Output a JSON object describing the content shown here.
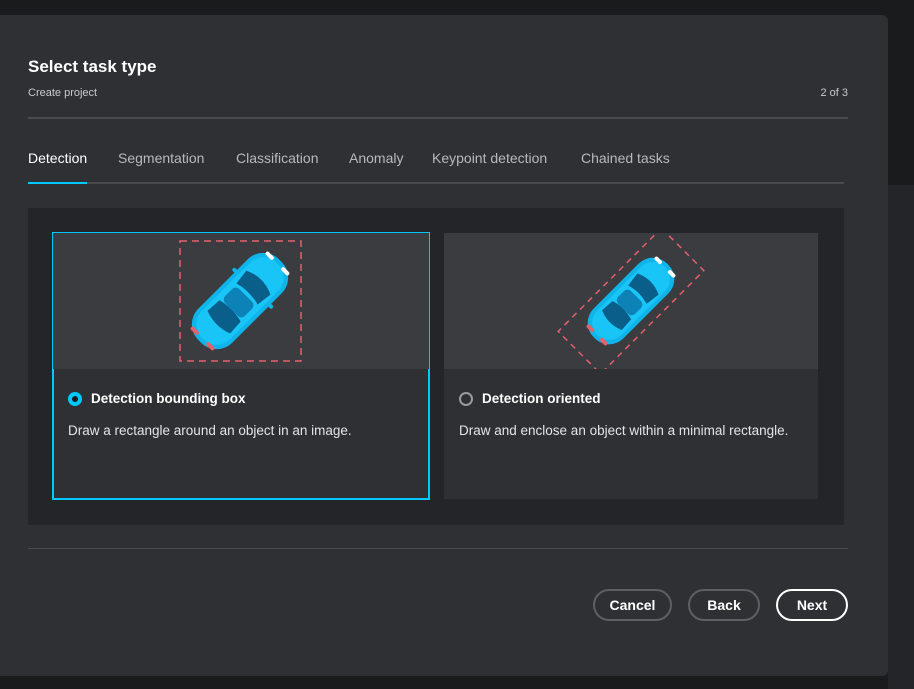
{
  "dialog": {
    "title": "Select task type",
    "subtitle": "Create project",
    "step": "2 of 3"
  },
  "tabs": [
    {
      "label": "Detection",
      "active": true
    },
    {
      "label": "Segmentation",
      "active": false
    },
    {
      "label": "Classification",
      "active": false
    },
    {
      "label": "Anomaly",
      "active": false
    },
    {
      "label": "Keypoint detection",
      "active": false
    },
    {
      "label": "Chained tasks",
      "active": false
    }
  ],
  "cards": [
    {
      "title": "Detection bounding box",
      "description": "Draw a rectangle around an object in an image.",
      "selected": true,
      "icon": "car-bounding-box-illustration"
    },
    {
      "title": "Detection oriented",
      "description": "Draw and enclose an object within a minimal rectangle.",
      "selected": false,
      "icon": "car-oriented-box-illustration"
    }
  ],
  "footer": {
    "cancel_label": "Cancel",
    "back_label": "Back",
    "next_label": "Next"
  },
  "colors": {
    "accent": "#00c7fd",
    "dialog_bg": "#2f3034",
    "annotation_box": "#e5606b"
  }
}
